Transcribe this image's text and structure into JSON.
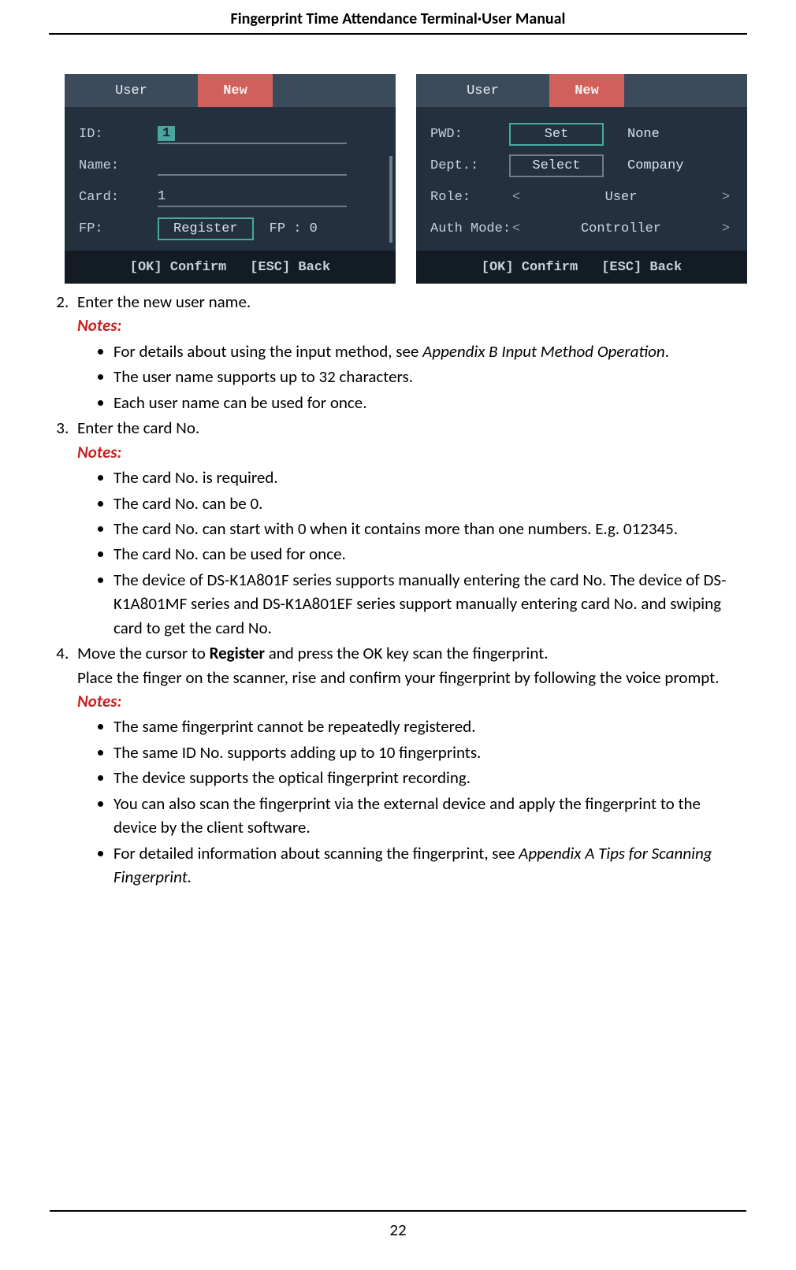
{
  "header": {
    "title": "Fingerprint Time Attendance Terminal·User Manual"
  },
  "page_number": "22",
  "screens": {
    "left": {
      "tabs": {
        "user": "User",
        "new": "New"
      },
      "id_label": "ID:",
      "id_value": "1",
      "name_label": "Name:",
      "card_label": "Card:",
      "card_value": "1",
      "fp_label": "FP:",
      "register_btn": "Register",
      "fp_count_label": "FP : 0",
      "status_ok": "[OK] Confirm",
      "status_esc": "[ESC] Back"
    },
    "right": {
      "tabs": {
        "user": "User",
        "new": "New"
      },
      "pwd_label": "PWD:",
      "pwd_btn": "Set",
      "pwd_status": "None",
      "dept_label": "Dept.:",
      "dept_btn": "Select",
      "dept_status": "Company",
      "role_label": "Role:",
      "role_value": "User",
      "auth_label": "Auth Mode:",
      "auth_value": "Controller",
      "arrow_left": "<",
      "arrow_right": ">",
      "status_ok": "[OK] Confirm",
      "status_esc": "[ESC] Back"
    }
  },
  "text": {
    "step2": "Enter the new user name.",
    "notes_label": "Notes:",
    "step2_notes": {
      "n1a": "For details about using the input method, see ",
      "n1b": "Appendix B Input Method Operation",
      "n1c": ".",
      "n2": "The user name supports up to 32 characters.",
      "n3": "Each user name can be used for once."
    },
    "step3": "Enter the card No.",
    "step3_notes": {
      "n1": "The card No. is required.",
      "n2": "The card No. can be 0.",
      "n3": "The card No. can start with 0 when it contains more than one numbers. E.g. 012345.",
      "n4": "The card No. can be used for once.",
      "n5": "The device of DS-K1A801F series supports manually entering the card No. The device of DS-K1A801MF series and DS-K1A801EF series support manually entering card No. and swiping card to get the card No."
    },
    "step4a": "Move the cursor to ",
    "step4b": "Register",
    "step4c": " and press the OK key scan the fingerprint.",
    "step4_extra": "Place the finger on the scanner, rise and confirm your fingerprint by following the voice prompt.",
    "step4_notes": {
      "n1": "The same fingerprint cannot be repeatedly registered.",
      "n2": "The same ID No. supports adding up to 10 fingerprints.",
      "n3": "The device supports the optical fingerprint recording.",
      "n4": "You can also scan the fingerprint via the external device and apply the fingerprint to the device by the client software.",
      "n5a": "For detailed information about scanning the fingerprint, see ",
      "n5b": "Appendix A Tips for Scanning Fingerprint."
    }
  }
}
